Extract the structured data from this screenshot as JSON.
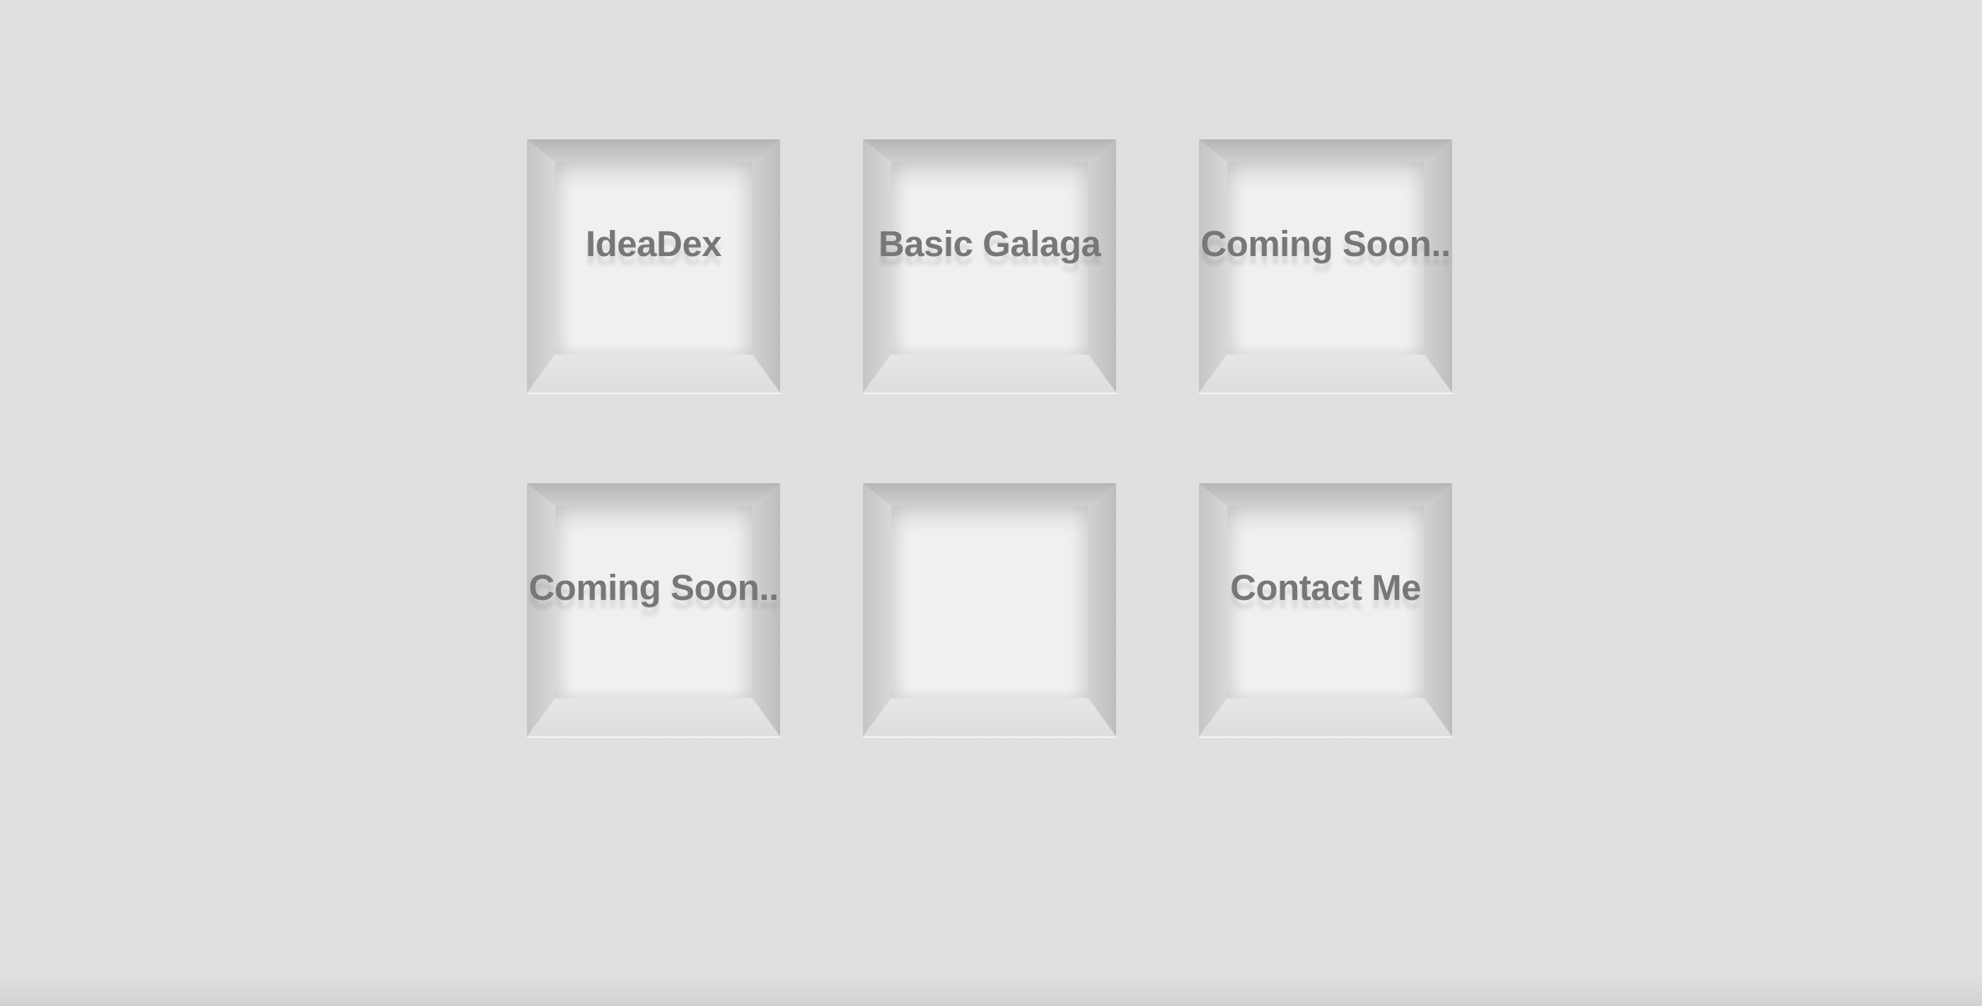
{
  "tiles": [
    {
      "label": "IdeaDex"
    },
    {
      "label": "Basic Galaga"
    },
    {
      "label": "Coming Soon.."
    },
    {
      "label": "Coming Soon.."
    },
    {
      "label": ""
    },
    {
      "label": "Contact Me"
    }
  ],
  "colors": {
    "background": "#e0e0e0",
    "box_face": "#f0f0f0",
    "label_text": "#777777"
  }
}
